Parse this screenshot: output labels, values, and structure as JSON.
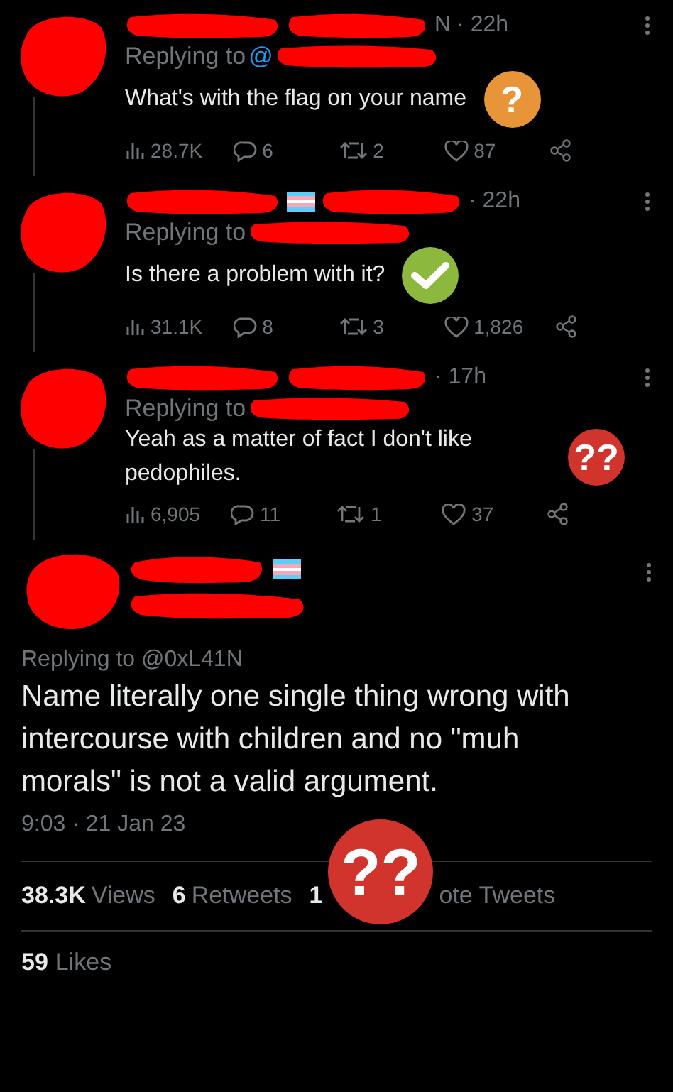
{
  "replies": [
    {
      "name_fragment": "N",
      "time": "· 22h",
      "flag": false,
      "replying_to": "Replying to",
      "replying_glyph": "@",
      "text": "What's with the flag on your name",
      "badge": {
        "kind": "question",
        "text": "?"
      },
      "stats": {
        "views": "28.7K",
        "replies": "6",
        "retweets": "2",
        "likes": "87"
      }
    },
    {
      "time": "· 22h",
      "flag": true,
      "replying_to": "Replying to",
      "text": "Is there a problem with it?",
      "badge": {
        "kind": "check"
      },
      "stats": {
        "views": "31.1K",
        "replies": "8",
        "retweets": "3",
        "likes": "1,826"
      }
    },
    {
      "time": "· 17h",
      "flag": false,
      "replying_to": "Replying to",
      "text": "Yeah as a matter of fact I don't like pedophiles.",
      "badge": {
        "kind": "double-question",
        "text": "??"
      },
      "stats": {
        "views": "6,905",
        "replies": "11",
        "retweets": "1",
        "likes": "37"
      }
    }
  ],
  "main_tweet": {
    "flag": true,
    "replying_to": "Replying to @0xL41N",
    "text": "Name literally one single thing wrong with intercourse with children and no \"muh morals\" is not a valid argument.",
    "timestamp": "9:03 · 21 Jan 23",
    "stats": [
      {
        "count": "38.3K",
        "label": "Views"
      },
      {
        "count": "6",
        "label": "Retweets"
      },
      {
        "count": "1",
        "label": "ote Tweets",
        "covered": true
      }
    ],
    "badge": {
      "kind": "double-question",
      "text": "??"
    },
    "likes": {
      "count": "59",
      "label": "Likes"
    }
  }
}
